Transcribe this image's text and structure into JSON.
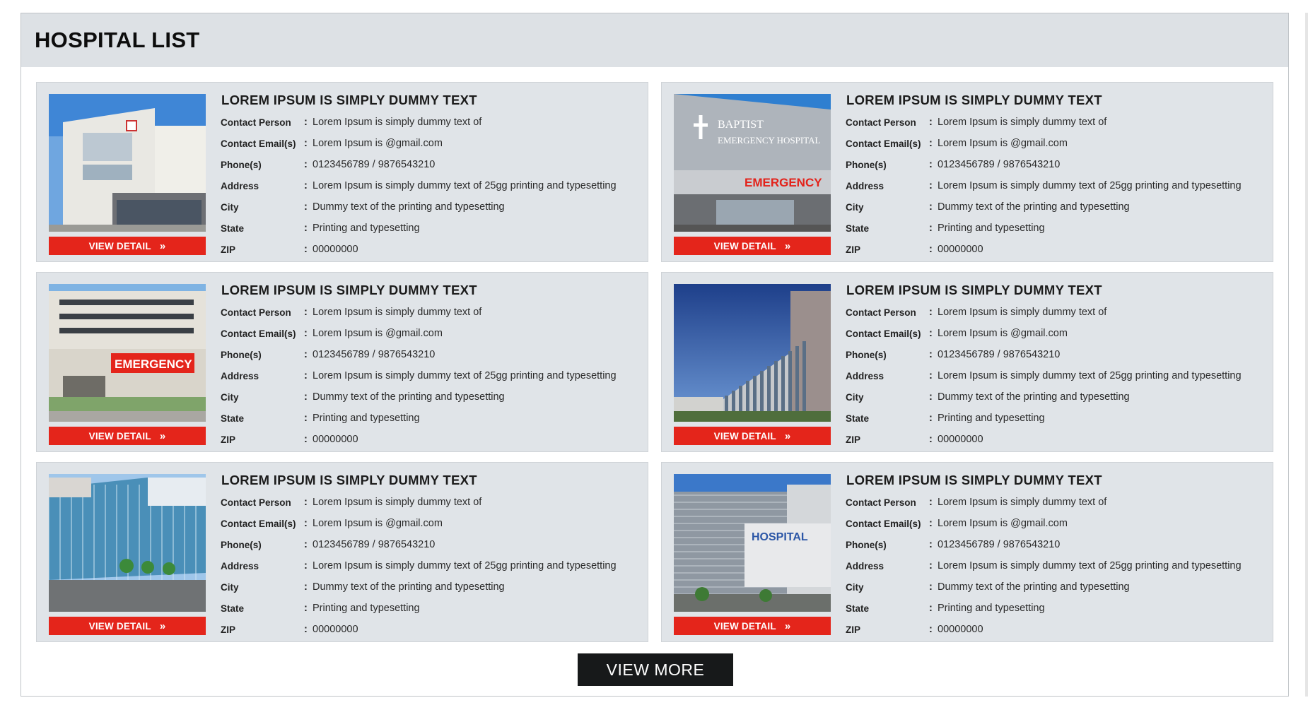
{
  "page": {
    "title": "HOSPITAL LIST"
  },
  "hospitals": [
    {
      "name": "LOREM IPSUM IS SIMPLY DUMMY TEXT",
      "image_icon": "hospital-building-photo-1",
      "fields": [
        {
          "label": "Contact Person",
          "value": "Lorem Ipsum is simply dummy text of"
        },
        {
          "label": "Contact Email(s)",
          "value": "Lorem Ipsum is @gmail.com"
        },
        {
          "label": "Phone(s)",
          "value": "0123456789 / 9876543210"
        },
        {
          "label": "Address",
          "value": "Lorem Ipsum is simply dummy text of 25gg printing and typesetting"
        },
        {
          "label": "City",
          "value": "Dummy text of the printing and typesetting"
        },
        {
          "label": "State",
          "value": "Printing and typesetting"
        },
        {
          "label": "ZIP",
          "value": "00000000"
        }
      ],
      "button_label": "VIEW DETAIL"
    },
    {
      "name": "LOREM IPSUM IS SIMPLY DUMMY TEXT",
      "image_icon": "hospital-building-photo-2",
      "fields": [
        {
          "label": "Contact Person",
          "value": "Lorem Ipsum is simply dummy text of"
        },
        {
          "label": "Contact Email(s)",
          "value": "Lorem Ipsum is @gmail.com"
        },
        {
          "label": "Phone(s)",
          "value": "0123456789 / 9876543210"
        },
        {
          "label": "Address",
          "value": "Lorem Ipsum is simply dummy text of 25gg printing and typesetting"
        },
        {
          "label": "City",
          "value": "Dummy text of the printing and typesetting"
        },
        {
          "label": "State",
          "value": "Printing and typesetting"
        },
        {
          "label": "ZIP",
          "value": "00000000"
        }
      ],
      "button_label": "VIEW DETAIL"
    },
    {
      "name": "LOREM IPSUM IS SIMPLY DUMMY TEXT",
      "image_icon": "hospital-building-photo-3",
      "fields": [
        {
          "label": "Contact Person",
          "value": "Lorem Ipsum is simply dummy text of"
        },
        {
          "label": "Contact Email(s)",
          "value": "Lorem Ipsum is @gmail.com"
        },
        {
          "label": "Phone(s)",
          "value": "0123456789 / 9876543210"
        },
        {
          "label": "Address",
          "value": "Lorem Ipsum is simply dummy text of 25gg printing and typesetting"
        },
        {
          "label": "City",
          "value": "Dummy text of the printing and typesetting"
        },
        {
          "label": "State",
          "value": "Printing and typesetting"
        },
        {
          "label": "ZIP",
          "value": "00000000"
        }
      ],
      "button_label": "VIEW DETAIL"
    },
    {
      "name": "LOREM IPSUM IS SIMPLY DUMMY TEXT",
      "image_icon": "hospital-building-photo-4",
      "fields": [
        {
          "label": "Contact Person",
          "value": "Lorem Ipsum is simply dummy text of"
        },
        {
          "label": "Contact Email(s)",
          "value": "Lorem Ipsum is @gmail.com"
        },
        {
          "label": "Phone(s)",
          "value": "0123456789 / 9876543210"
        },
        {
          "label": "Address",
          "value": "Lorem Ipsum is simply dummy text of 25gg printing and typesetting"
        },
        {
          "label": "City",
          "value": "Dummy text of the printing and typesetting"
        },
        {
          "label": "State",
          "value": "Printing and typesetting"
        },
        {
          "label": "ZIP",
          "value": "00000000"
        }
      ],
      "button_label": "VIEW DETAIL"
    },
    {
      "name": "LOREM IPSUM IS SIMPLY DUMMY TEXT",
      "image_icon": "hospital-building-photo-5",
      "fields": [
        {
          "label": "Contact Person",
          "value": "Lorem Ipsum is simply dummy text of"
        },
        {
          "label": "Contact Email(s)",
          "value": "Lorem Ipsum is @gmail.com"
        },
        {
          "label": "Phone(s)",
          "value": "0123456789 / 9876543210"
        },
        {
          "label": "Address",
          "value": "Lorem Ipsum is simply dummy text of 25gg printing and typesetting"
        },
        {
          "label": "City",
          "value": "Dummy text of the printing and typesetting"
        },
        {
          "label": "State",
          "value": "Printing and typesetting"
        },
        {
          "label": "ZIP",
          "value": "00000000"
        }
      ],
      "button_label": "VIEW DETAIL"
    },
    {
      "name": "LOREM IPSUM IS SIMPLY DUMMY TEXT",
      "image_icon": "hospital-building-photo-6",
      "fields": [
        {
          "label": "Contact Person",
          "value": "Lorem Ipsum is simply dummy text of"
        },
        {
          "label": "Contact Email(s)",
          "value": "Lorem Ipsum is @gmail.com"
        },
        {
          "label": "Phone(s)",
          "value": "0123456789 / 9876543210"
        },
        {
          "label": "Address",
          "value": "Lorem Ipsum is simply dummy text of 25gg printing and typesetting"
        },
        {
          "label": "City",
          "value": "Dummy text of the printing and typesetting"
        },
        {
          "label": "State",
          "value": "Printing and typesetting"
        },
        {
          "label": "ZIP",
          "value": "00000000"
        }
      ],
      "button_label": "VIEW DETAIL"
    }
  ],
  "image_signs": {
    "card2_sign_1": "BAPTIST",
    "card2_sign_2": "EMERGENCY HOSPITAL",
    "card2_sign_3": "EMERGENCY",
    "card3_sign": "EMERGENCY",
    "card6_sign": "HOSPITAL"
  },
  "view_more_label": "VIEW MORE",
  "colors": {
    "header_bg": "#dde1e5",
    "card_bg": "#e0e4e8",
    "detail_button": "#e4251b",
    "view_more_button": "#17191a"
  }
}
